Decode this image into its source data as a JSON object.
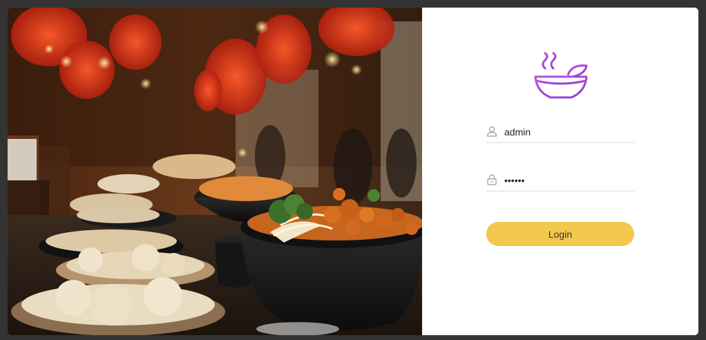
{
  "hero": {
    "description_icon": "restaurant-food-photo"
  },
  "login": {
    "logo_icon": "steaming-bowl-icon",
    "username": {
      "icon": "user-icon",
      "value": "admin",
      "placeholder": ""
    },
    "password": {
      "icon": "lock-icon",
      "value": "••••••",
      "placeholder": ""
    },
    "button_label": "Login"
  },
  "colors": {
    "accent": "#f2c94c",
    "logo_gradient_start": "#c44bd8",
    "logo_gradient_end": "#8a3fd6",
    "background": "#333333"
  }
}
